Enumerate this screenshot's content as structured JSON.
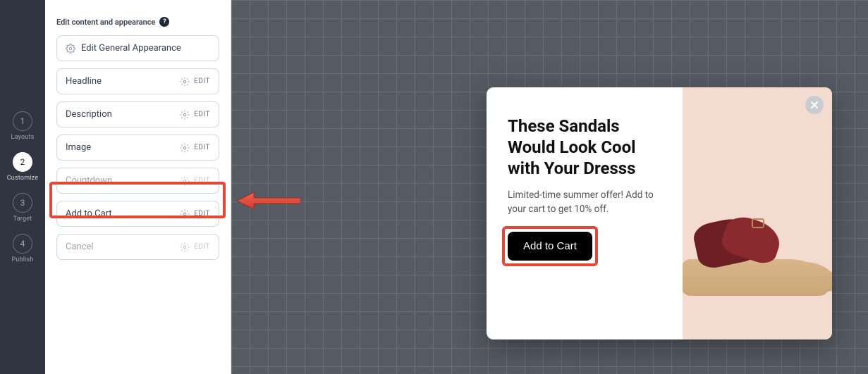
{
  "steps": [
    {
      "num": "1",
      "label": "Layouts"
    },
    {
      "num": "2",
      "label": "Customize"
    },
    {
      "num": "3",
      "label": "Target"
    },
    {
      "num": "4",
      "label": "Publish"
    }
  ],
  "activeStepIndex": 1,
  "sidebar": {
    "header": "Edit content and appearance",
    "generalBtn": "Edit General Appearance",
    "editLabel": "EDIT",
    "blocks": [
      {
        "label": "Headline",
        "enabled": true
      },
      {
        "label": "Description",
        "enabled": true
      },
      {
        "label": "Image",
        "enabled": true
      },
      {
        "label": "Countdown",
        "enabled": false
      },
      {
        "label": "Add to Cart",
        "enabled": true
      },
      {
        "label": "Cancel",
        "enabled": false
      }
    ],
    "highlightedBlockIndex": 4
  },
  "popup": {
    "headline": "These Sandals Would Look Cool with Your Dresss",
    "description": "Limited-time summer offer! Add to your cart to get 10% off.",
    "cta": "Add to Cart"
  }
}
